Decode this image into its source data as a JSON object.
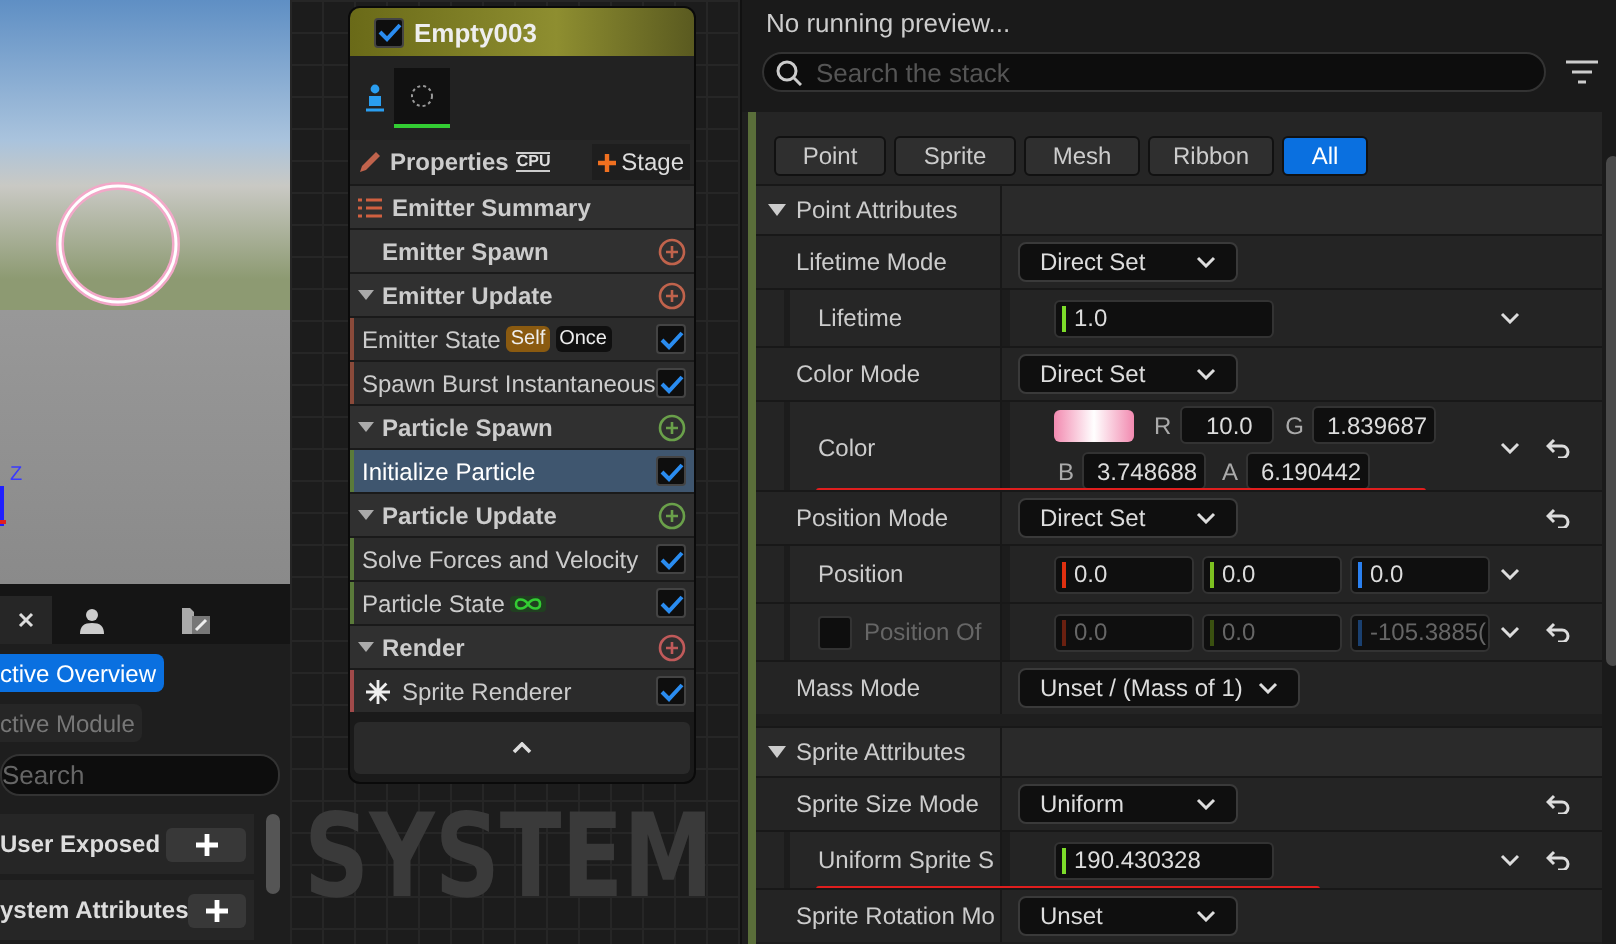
{
  "viewport": {
    "axis_label": "Z"
  },
  "left_panel": {
    "tabs": [
      {
        "kind": "close",
        "selected": true
      },
      {
        "kind": "person",
        "selected": false
      },
      {
        "kind": "edit",
        "selected": false
      }
    ],
    "mode_buttons": [
      {
        "label": "ctive Overview",
        "selected": true
      },
      {
        "label": "ctive Module",
        "selected": false
      }
    ],
    "search": {
      "placeholder": "Search"
    },
    "categories": [
      {
        "label": "User Exposed"
      },
      {
        "label": "ystem Attributes"
      }
    ]
  },
  "node": {
    "title": "Empty003",
    "enabled": true,
    "properties_label": "Properties",
    "sim_target": "CPU",
    "stage_button": "Stage",
    "items": [
      {
        "kind": "summary",
        "label": "Emitter Summary"
      },
      {
        "kind": "group",
        "label": "Emitter Spawn",
        "expandable": false,
        "color": "#c0634c"
      },
      {
        "kind": "group",
        "label": "Emitter Update",
        "expandable": true,
        "color": "#c0634c"
      },
      {
        "kind": "module",
        "label": "Emitter State",
        "enabled": true,
        "selected": false,
        "color": "#8a4a3a",
        "badges": [
          {
            "text": "Self",
            "color": "#8a5a10"
          },
          {
            "text": "Once",
            "color": "#101010"
          }
        ]
      },
      {
        "kind": "module",
        "label": "Spawn Burst Instantaneous",
        "enabled": true,
        "selected": false,
        "color": "#8a4a3a"
      },
      {
        "kind": "group",
        "label": "Particle Spawn",
        "expandable": true,
        "color": "#6aa04a"
      },
      {
        "kind": "module",
        "label": "Initialize Particle",
        "enabled": true,
        "selected": true,
        "color": "#5a7a3a"
      },
      {
        "kind": "group",
        "label": "Particle Update",
        "expandable": true,
        "color": "#6aa04a"
      },
      {
        "kind": "module",
        "label": "Solve Forces and Velocity",
        "enabled": true,
        "selected": false,
        "color": "#5a7a3a"
      },
      {
        "kind": "module",
        "label": "Particle State",
        "enabled": true,
        "selected": false,
        "color": "#5a7a3a",
        "loop": true
      },
      {
        "kind": "group",
        "label": "Render",
        "expandable": true,
        "color": "#c05a5a"
      },
      {
        "kind": "renderer",
        "label": "Sprite Renderer",
        "enabled": true,
        "selected": false,
        "color": "#a04a4a"
      }
    ]
  },
  "graph": {
    "watermark_text": "SYSTEM"
  },
  "stack": {
    "status": "No running preview...",
    "search": {
      "placeholder": "Search the stack"
    },
    "filter_tabs": [
      {
        "label": "Point",
        "selected": false
      },
      {
        "label": "Sprite",
        "selected": false
      },
      {
        "label": "Mesh",
        "selected": false
      },
      {
        "label": "Ribbon",
        "selected": false
      },
      {
        "label": "All",
        "selected": true
      }
    ],
    "rows": [
      {
        "kind": "section",
        "label": "Point Attributes"
      },
      {
        "kind": "dropdown",
        "label": "Lifetime Mode",
        "value": "Direct Set",
        "reset": false
      },
      {
        "kind": "float",
        "label": "Lifetime",
        "value": "1.0",
        "reset": false,
        "highlighted": false
      },
      {
        "kind": "dropdown",
        "label": "Color Mode",
        "value": "Direct Set",
        "reset": false
      },
      {
        "kind": "color",
        "label": "Color",
        "channel_labels": [
          "R",
          "G",
          "B",
          "A"
        ],
        "r": "10.0",
        "g": "1.839687",
        "b": "3.748688",
        "a": "6.190442",
        "reset": true,
        "highlighted": true
      },
      {
        "kind": "dropdown",
        "label": "Position Mode",
        "value": "Direct Set",
        "reset": true
      },
      {
        "kind": "vector",
        "label": "Position",
        "values": [
          "0.0",
          "0.0",
          "0.0"
        ],
        "disabled": false,
        "reset": false
      },
      {
        "kind": "vector",
        "label": "Position Of",
        "values": [
          "0.0",
          "0.0",
          "-105.3885("
        ],
        "disabled": true,
        "checkbox": true,
        "checked": false,
        "reset": true
      },
      {
        "kind": "dropdown",
        "label": "Mass Mode",
        "value": "Unset / (Mass of 1)",
        "reset": false
      },
      {
        "kind": "section",
        "label": "Sprite Attributes"
      },
      {
        "kind": "dropdown",
        "label": "Sprite Size Mode",
        "value": "Uniform",
        "reset": true
      },
      {
        "kind": "float",
        "label": "Uniform Sprite S",
        "value": "190.430328",
        "reset": true,
        "highlighted": true
      },
      {
        "kind": "dropdown",
        "label": "Sprite Rotation Mo",
        "value": "Unset",
        "reset": false
      }
    ]
  }
}
